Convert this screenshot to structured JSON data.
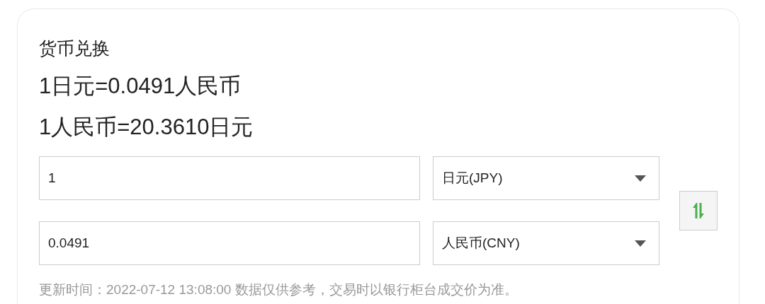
{
  "title": "货币兑换",
  "rates": [
    "1日元=0.0491人民币",
    "1人民币=20.3610日元"
  ],
  "rows": [
    {
      "amount": "1",
      "currency": "日元(JPY)"
    },
    {
      "amount": "0.0491",
      "currency": "人民币(CNY)"
    }
  ],
  "footer": "更新时间：2022-07-12 13:08:00 数据仅供参考，交易时以银行柜台成交价为准。"
}
